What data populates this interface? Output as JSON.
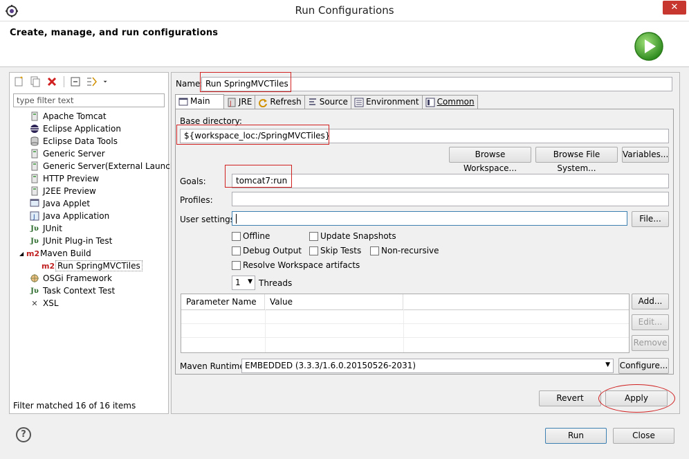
{
  "window": {
    "title": "Run Configurations",
    "close_icon": "close-icon",
    "app_icon": "eclipse-icon"
  },
  "header": {
    "heading": "Create, manage, and run configurations",
    "logo": "run-icon"
  },
  "left": {
    "filter_placeholder": "type filter text",
    "toolbar_icons": [
      "new-configuration-icon",
      "duplicate-icon",
      "delete-icon",
      "collapse-all-icon",
      "filter-icon",
      "view-menu-icon"
    ],
    "tree": [
      {
        "label": "Apache Tomcat",
        "icon": "tomcat-icon"
      },
      {
        "label": "Eclipse Application",
        "icon": "eclipse-icon"
      },
      {
        "label": "Eclipse Data Tools",
        "icon": "database-icon"
      },
      {
        "label": "Generic Server",
        "icon": "server-icon"
      },
      {
        "label": "Generic Server(External Launch)",
        "icon": "server-icon"
      },
      {
        "label": "HTTP Preview",
        "icon": "server-icon"
      },
      {
        "label": "J2EE Preview",
        "icon": "server-icon"
      },
      {
        "label": "Java Applet",
        "icon": "applet-icon"
      },
      {
        "label": "Java Application",
        "icon": "java-app-icon"
      },
      {
        "label": "JUnit",
        "icon": "junit-icon"
      },
      {
        "label": "JUnit Plug-in Test",
        "icon": "junit-plugin-icon"
      },
      {
        "label": "Maven Build",
        "icon": "maven-icon"
      },
      {
        "label": "Run SpringMVCTiles",
        "icon": "maven-icon"
      },
      {
        "label": "OSGi Framework",
        "icon": "osgi-icon"
      },
      {
        "label": "Task Context Test",
        "icon": "junit-icon"
      },
      {
        "label": "XSL",
        "icon": "xsl-icon"
      }
    ],
    "status": "Filter matched 16 of 16 items"
  },
  "form": {
    "name_label": "Name:",
    "name_value": "Run SpringMVCTiles",
    "tabs": [
      "Main",
      "JRE",
      "Refresh",
      "Source",
      "Environment",
      "Common"
    ],
    "base_dir_label": "Base directory:",
    "base_dir_value": "${workspace_loc:/SpringMVCTiles}",
    "browse_workspace": "Browse Workspace...",
    "browse_fs": "Browse File System...",
    "variables": "Variables...",
    "goals_label": "Goals:",
    "goals_value": "tomcat7:run",
    "profiles_label": "Profiles:",
    "profiles_value": "",
    "user_settings_label": "User settings:",
    "user_settings_value": "",
    "file_button": "File...",
    "offline": "Offline",
    "update_snapshots": "Update Snapshots",
    "debug_output": "Debug Output",
    "skip_tests": "Skip Tests",
    "non_recursive": "Non-recursive",
    "resolve_workspace": "Resolve Workspace artifacts",
    "threads_value": "1",
    "threads_label": "Threads",
    "table_col1": "Parameter Name",
    "table_col2": "Value",
    "add_button": "Add...",
    "edit_button": "Edit...",
    "remove_button": "Remove",
    "runtime_label": "Maven Runtime:",
    "runtime_value": "EMBEDDED (3.3.3/1.6.0.20150526-2031)",
    "configure_button": "Configure...",
    "revert_button": "Revert",
    "apply_button": "Apply"
  },
  "footer": {
    "run_button": "Run",
    "close_button": "Close",
    "help_icon": "help-icon"
  }
}
